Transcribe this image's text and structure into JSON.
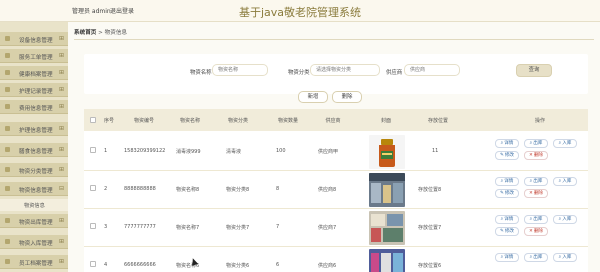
{
  "header": {
    "admin_label": "管理员 admin",
    "logout_label": "退出登录",
    "title": "基于java敬老院管理系统"
  },
  "sidebar": {
    "items": [
      {
        "label": "设备信息管理"
      },
      {
        "label": "服务工单管理"
      },
      {
        "label": "健康档案管理"
      },
      {
        "label": "护理记录管理"
      },
      {
        "label": "费用信息管理"
      },
      {
        "label": "护理信息管理"
      },
      {
        "label": "膳食信息管理"
      },
      {
        "label": "物资分类管理"
      },
      {
        "label": "物资信息管理"
      },
      {
        "label": "物资出库管理"
      },
      {
        "label": "物资入库管理"
      },
      {
        "label": "员工档案管理"
      }
    ],
    "sub_item": "物资信息"
  },
  "breadcrumb": {
    "home": "系统首页",
    "sep": ">",
    "current": "物资信息"
  },
  "search": {
    "name_label": "物资名称",
    "name_placeholder": "物资名称",
    "category_label": "物资分类",
    "category_placeholder": "请选择物资分类",
    "supplier_label": "供应商",
    "supplier_placeholder": "供应商",
    "button": "查询"
  },
  "actions": {
    "add": "新增",
    "delete": "删除"
  },
  "table": {
    "headers": [
      "序号",
      "物资编号",
      "物资名称",
      "物资分类",
      "物资数量",
      "供应商",
      "封面",
      "存放位置",
      "操作"
    ],
    "rows": [
      {
        "index": "1",
        "code": "1583209399122",
        "name": "消毒液999",
        "category": "清毒液",
        "qty": "100",
        "supplier": "供应商甲",
        "location": "11",
        "thumb": "bottle"
      },
      {
        "index": "2",
        "code": "8888888888",
        "name": "物资名称8",
        "category": "物资分类8",
        "qty": "8",
        "supplier": "供应商8",
        "location": "存放位置8",
        "thumb": "store"
      },
      {
        "index": "3",
        "code": "7777777777",
        "name": "物资名称7",
        "category": "物资分类7",
        "qty": "7",
        "supplier": "供应商7",
        "location": "存放位置7",
        "thumb": "store2"
      },
      {
        "index": "4",
        "code": "6666666666",
        "name": "物资名称6",
        "category": "物资分类6",
        "qty": "6",
        "supplier": "供应商6",
        "location": "存放位置6",
        "thumb": "store3"
      }
    ],
    "row_actions": {
      "detail": "详情",
      "out": "出库",
      "in": "入库",
      "edit": "修改",
      "remove": "删除"
    }
  },
  "colors": {
    "accent": "#8a7b3c",
    "sidebar_bg": "#d8d0aa",
    "action_blue": "#3a6ea5",
    "delete_red": "#c0392b"
  }
}
